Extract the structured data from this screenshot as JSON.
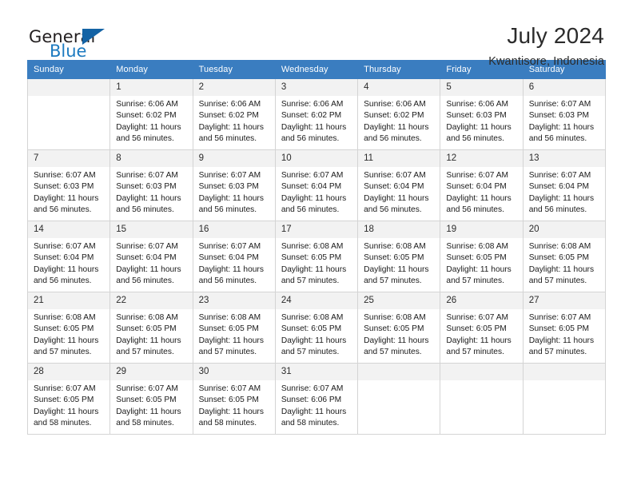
{
  "brand": {
    "name_part1": "General",
    "name_part2": "Blue",
    "triangle_color": "#1463a5",
    "blue_text_color": "#1c7ac0"
  },
  "header": {
    "title": "July 2024",
    "subtitle": "Kwantisore, Indonesia"
  },
  "theme": {
    "header_row_bg": "#3a7dc0",
    "header_row_text": "#ffffff",
    "daynum_bg": "#f2f2f2",
    "cell_border": "#d4d4d4"
  },
  "weekdays": [
    "Sunday",
    "Monday",
    "Tuesday",
    "Wednesday",
    "Thursday",
    "Friday",
    "Saturday"
  ],
  "weeks": [
    [
      {
        "day": "",
        "sunrise": "",
        "sunset": "",
        "daylight_line1": "",
        "daylight_line2": "",
        "empty": true
      },
      {
        "day": "1",
        "sunrise": "Sunrise: 6:06 AM",
        "sunset": "Sunset: 6:02 PM",
        "daylight_line1": "Daylight: 11 hours",
        "daylight_line2": "and 56 minutes."
      },
      {
        "day": "2",
        "sunrise": "Sunrise: 6:06 AM",
        "sunset": "Sunset: 6:02 PM",
        "daylight_line1": "Daylight: 11 hours",
        "daylight_line2": "and 56 minutes."
      },
      {
        "day": "3",
        "sunrise": "Sunrise: 6:06 AM",
        "sunset": "Sunset: 6:02 PM",
        "daylight_line1": "Daylight: 11 hours",
        "daylight_line2": "and 56 minutes."
      },
      {
        "day": "4",
        "sunrise": "Sunrise: 6:06 AM",
        "sunset": "Sunset: 6:02 PM",
        "daylight_line1": "Daylight: 11 hours",
        "daylight_line2": "and 56 minutes."
      },
      {
        "day": "5",
        "sunrise": "Sunrise: 6:06 AM",
        "sunset": "Sunset: 6:03 PM",
        "daylight_line1": "Daylight: 11 hours",
        "daylight_line2": "and 56 minutes."
      },
      {
        "day": "6",
        "sunrise": "Sunrise: 6:07 AM",
        "sunset": "Sunset: 6:03 PM",
        "daylight_line1": "Daylight: 11 hours",
        "daylight_line2": "and 56 minutes."
      }
    ],
    [
      {
        "day": "7",
        "sunrise": "Sunrise: 6:07 AM",
        "sunset": "Sunset: 6:03 PM",
        "daylight_line1": "Daylight: 11 hours",
        "daylight_line2": "and 56 minutes."
      },
      {
        "day": "8",
        "sunrise": "Sunrise: 6:07 AM",
        "sunset": "Sunset: 6:03 PM",
        "daylight_line1": "Daylight: 11 hours",
        "daylight_line2": "and 56 minutes."
      },
      {
        "day": "9",
        "sunrise": "Sunrise: 6:07 AM",
        "sunset": "Sunset: 6:03 PM",
        "daylight_line1": "Daylight: 11 hours",
        "daylight_line2": "and 56 minutes."
      },
      {
        "day": "10",
        "sunrise": "Sunrise: 6:07 AM",
        "sunset": "Sunset: 6:04 PM",
        "daylight_line1": "Daylight: 11 hours",
        "daylight_line2": "and 56 minutes."
      },
      {
        "day": "11",
        "sunrise": "Sunrise: 6:07 AM",
        "sunset": "Sunset: 6:04 PM",
        "daylight_line1": "Daylight: 11 hours",
        "daylight_line2": "and 56 minutes."
      },
      {
        "day": "12",
        "sunrise": "Sunrise: 6:07 AM",
        "sunset": "Sunset: 6:04 PM",
        "daylight_line1": "Daylight: 11 hours",
        "daylight_line2": "and 56 minutes."
      },
      {
        "day": "13",
        "sunrise": "Sunrise: 6:07 AM",
        "sunset": "Sunset: 6:04 PM",
        "daylight_line1": "Daylight: 11 hours",
        "daylight_line2": "and 56 minutes."
      }
    ],
    [
      {
        "day": "14",
        "sunrise": "Sunrise: 6:07 AM",
        "sunset": "Sunset: 6:04 PM",
        "daylight_line1": "Daylight: 11 hours",
        "daylight_line2": "and 56 minutes."
      },
      {
        "day": "15",
        "sunrise": "Sunrise: 6:07 AM",
        "sunset": "Sunset: 6:04 PM",
        "daylight_line1": "Daylight: 11 hours",
        "daylight_line2": "and 56 minutes."
      },
      {
        "day": "16",
        "sunrise": "Sunrise: 6:07 AM",
        "sunset": "Sunset: 6:04 PM",
        "daylight_line1": "Daylight: 11 hours",
        "daylight_line2": "and 56 minutes."
      },
      {
        "day": "17",
        "sunrise": "Sunrise: 6:08 AM",
        "sunset": "Sunset: 6:05 PM",
        "daylight_line1": "Daylight: 11 hours",
        "daylight_line2": "and 57 minutes."
      },
      {
        "day": "18",
        "sunrise": "Sunrise: 6:08 AM",
        "sunset": "Sunset: 6:05 PM",
        "daylight_line1": "Daylight: 11 hours",
        "daylight_line2": "and 57 minutes."
      },
      {
        "day": "19",
        "sunrise": "Sunrise: 6:08 AM",
        "sunset": "Sunset: 6:05 PM",
        "daylight_line1": "Daylight: 11 hours",
        "daylight_line2": "and 57 minutes."
      },
      {
        "day": "20",
        "sunrise": "Sunrise: 6:08 AM",
        "sunset": "Sunset: 6:05 PM",
        "daylight_line1": "Daylight: 11 hours",
        "daylight_line2": "and 57 minutes."
      }
    ],
    [
      {
        "day": "21",
        "sunrise": "Sunrise: 6:08 AM",
        "sunset": "Sunset: 6:05 PM",
        "daylight_line1": "Daylight: 11 hours",
        "daylight_line2": "and 57 minutes."
      },
      {
        "day": "22",
        "sunrise": "Sunrise: 6:08 AM",
        "sunset": "Sunset: 6:05 PM",
        "daylight_line1": "Daylight: 11 hours",
        "daylight_line2": "and 57 minutes."
      },
      {
        "day": "23",
        "sunrise": "Sunrise: 6:08 AM",
        "sunset": "Sunset: 6:05 PM",
        "daylight_line1": "Daylight: 11 hours",
        "daylight_line2": "and 57 minutes."
      },
      {
        "day": "24",
        "sunrise": "Sunrise: 6:08 AM",
        "sunset": "Sunset: 6:05 PM",
        "daylight_line1": "Daylight: 11 hours",
        "daylight_line2": "and 57 minutes."
      },
      {
        "day": "25",
        "sunrise": "Sunrise: 6:08 AM",
        "sunset": "Sunset: 6:05 PM",
        "daylight_line1": "Daylight: 11 hours",
        "daylight_line2": "and 57 minutes."
      },
      {
        "day": "26",
        "sunrise": "Sunrise: 6:07 AM",
        "sunset": "Sunset: 6:05 PM",
        "daylight_line1": "Daylight: 11 hours",
        "daylight_line2": "and 57 minutes."
      },
      {
        "day": "27",
        "sunrise": "Sunrise: 6:07 AM",
        "sunset": "Sunset: 6:05 PM",
        "daylight_line1": "Daylight: 11 hours",
        "daylight_line2": "and 57 minutes."
      }
    ],
    [
      {
        "day": "28",
        "sunrise": "Sunrise: 6:07 AM",
        "sunset": "Sunset: 6:05 PM",
        "daylight_line1": "Daylight: 11 hours",
        "daylight_line2": "and 58 minutes."
      },
      {
        "day": "29",
        "sunrise": "Sunrise: 6:07 AM",
        "sunset": "Sunset: 6:05 PM",
        "daylight_line1": "Daylight: 11 hours",
        "daylight_line2": "and 58 minutes."
      },
      {
        "day": "30",
        "sunrise": "Sunrise: 6:07 AM",
        "sunset": "Sunset: 6:05 PM",
        "daylight_line1": "Daylight: 11 hours",
        "daylight_line2": "and 58 minutes."
      },
      {
        "day": "31",
        "sunrise": "Sunrise: 6:07 AM",
        "sunset": "Sunset: 6:06 PM",
        "daylight_line1": "Daylight: 11 hours",
        "daylight_line2": "and 58 minutes."
      },
      {
        "day": "",
        "sunrise": "",
        "sunset": "",
        "daylight_line1": "",
        "daylight_line2": "",
        "empty": true
      },
      {
        "day": "",
        "sunrise": "",
        "sunset": "",
        "daylight_line1": "",
        "daylight_line2": "",
        "empty": true
      },
      {
        "day": "",
        "sunrise": "",
        "sunset": "",
        "daylight_line1": "",
        "daylight_line2": "",
        "empty": true
      }
    ]
  ]
}
